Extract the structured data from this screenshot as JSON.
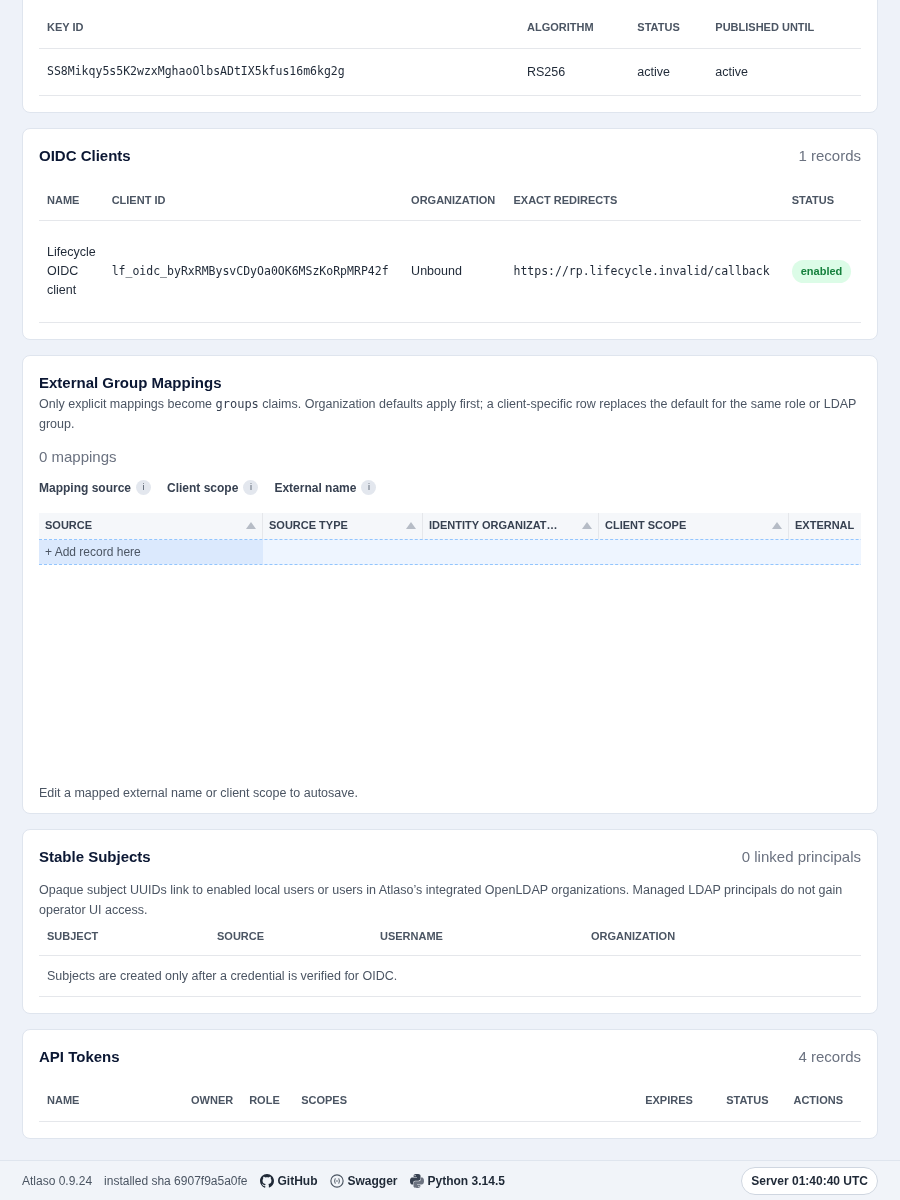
{
  "signing_keys": {
    "columns": [
      "KEY ID",
      "ALGORITHM",
      "STATUS",
      "PUBLISHED UNTIL"
    ],
    "rows": [
      [
        "SS8Mikqy5s5K2wzxMghaoOlbsADtIX5kfus16m6kg2g",
        "RS256",
        "active",
        "active"
      ]
    ]
  },
  "oidc_clients": {
    "title": "OIDC Clients",
    "count": "1 records",
    "columns": [
      "NAME",
      "CLIENT ID",
      "ORGANIZATION",
      "EXACT REDIRECTS",
      "STATUS"
    ],
    "rows": [
      {
        "name": "Lifecycle OIDC client",
        "client_id": "lf_oidc_byRxRMBysvCDyOa0OK6MSzKoRpMRP42f",
        "organization": "Unbound",
        "redirects": "https://rp.lifecycle.invalid/callback",
        "status": "enabled",
        "enabled": true
      }
    ]
  },
  "group_mappings": {
    "title": "External Group Mappings",
    "description": [
      {
        "kind": "text",
        "text": "Only explicit mappings become "
      },
      {
        "kind": "code",
        "text": "groups"
      },
      {
        "kind": "text",
        "text": " claims. Organization defaults apply first; a client-specific row replaces the default for the same role or LDAP group."
      }
    ],
    "count": "0 mappings",
    "help_labels": [
      {
        "label": "Mapping source",
        "info": "i"
      },
      {
        "label": "Client scope",
        "info": "i"
      },
      {
        "label": "External name",
        "info": "i"
      }
    ],
    "columns": [
      "SOURCE",
      "SOURCE TYPE",
      "IDENTITY ORGANIZAT…",
      "CLIENT SCOPE",
      "EXTERNAL"
    ],
    "add_row": "+ Add record here",
    "hint": "Edit a mapped external name or client scope to autosave."
  },
  "stable_subjects": {
    "title": "Stable Subjects",
    "count": "0 linked principals",
    "description": "Opaque subject UUIDs link to enabled local users or users in Atlaso’s integrated OpenLDAP organizations. Managed LDAP principals do not gain operator UI access.",
    "columns": [
      "SUBJECT",
      "SOURCE",
      "USERNAME",
      "ORGANIZATION"
    ],
    "empty": "Subjects are created only after a credential is verified for OIDC."
  },
  "api_tokens": {
    "title": "API Tokens",
    "count": "4 records",
    "columns": [
      "NAME",
      "OWNER",
      "ROLE",
      "SCOPES",
      "EXPIRES",
      "STATUS",
      "ACTIONS"
    ]
  },
  "footer": {
    "version": "Atlaso 0.9.24",
    "sha": "installed sha 6907f9a5a0fe",
    "links": [
      {
        "kind": "github",
        "label": "GitHub"
      },
      {
        "kind": "swagger",
        "label": "Swagger"
      },
      {
        "kind": "python",
        "label": "Python 3.14.5"
      }
    ],
    "server_time": "Server 01:40:40 UTC"
  }
}
